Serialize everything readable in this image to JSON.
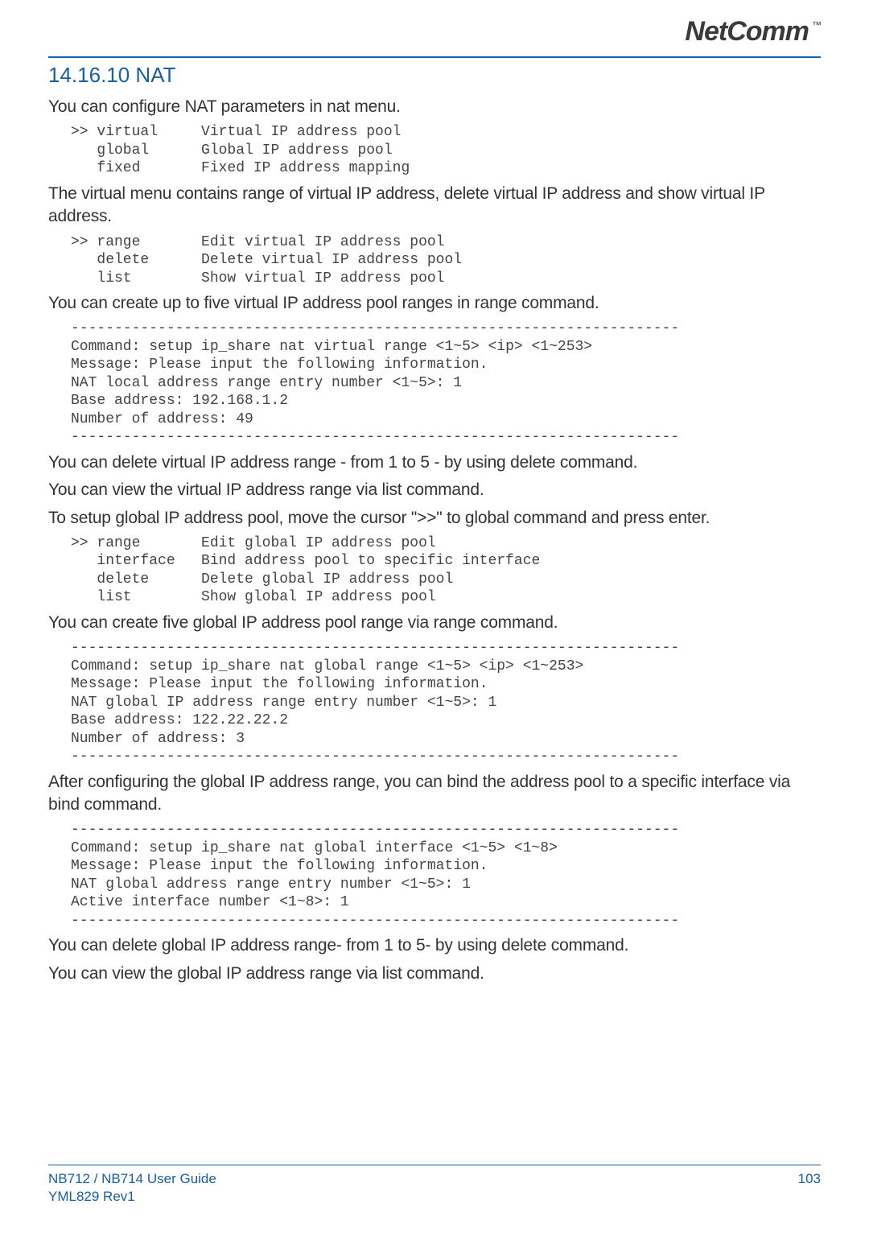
{
  "logo": {
    "text": "NetComm",
    "tm": "™"
  },
  "heading": "14.16.10 NAT",
  "p1": "You can configure NAT parameters in nat menu.",
  "code1": ">> virtual     Virtual IP address pool\n   global      Global IP address pool\n   fixed       Fixed IP address mapping",
  "p2": "The virtual menu contains range of virtual IP address, delete virtual IP address and show virtual IP address.",
  "code2": ">> range       Edit virtual IP address pool\n   delete      Delete virtual IP address pool\n   list        Show virtual IP address pool",
  "p3": "You can create up to five virtual IP address pool ranges in range command.",
  "code3": "----------------------------------------------------------------------\nCommand: setup ip_share nat virtual range <1~5> <ip> <1~253>\nMessage: Please input the following information.\nNAT local address range entry number <1~5>: 1\nBase address: 192.168.1.2\nNumber of address: 49\n----------------------------------------------------------------------",
  "p4": "You can delete virtual IP address range - from 1 to 5 - by using delete command.",
  "p5": "You can view the virtual IP address range via list command.",
  "p6": "To setup global IP address pool, move the cursor \">>\" to global command and press enter.",
  "code4": ">> range       Edit global IP address pool\n   interface   Bind address pool to specific interface\n   delete      Delete global IP address pool\n   list        Show global IP address pool",
  "p7": "You can create five global IP address pool range via range command.",
  "code5": "----------------------------------------------------------------------\nCommand: setup ip_share nat global range <1~5> <ip> <1~253>\nMessage: Please input the following information.\nNAT global IP address range entry number <1~5>: 1\nBase address: 122.22.22.2\nNumber of address: 3\n----------------------------------------------------------------------",
  "p8": "After configuring the global IP address range, you can bind the address pool to a specific interface via bind command.",
  "code6": "----------------------------------------------------------------------\nCommand: setup ip_share nat global interface <1~5> <1~8>\nMessage: Please input the following information.\nNAT global address range entry number <1~5>: 1\nActive interface number <1~8>: 1\n----------------------------------------------------------------------",
  "p9": "You can delete global IP address range- from 1 to 5- by using delete command.",
  "p10": "You can view the global IP address range via list command.",
  "footer": {
    "left1": "NB712 / NB714 User Guide",
    "left2": "YML829 Rev1",
    "right": "103"
  }
}
